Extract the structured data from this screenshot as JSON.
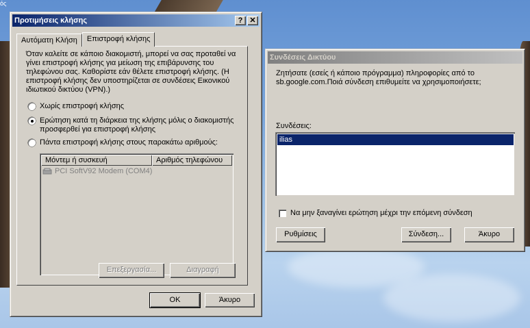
{
  "desktop": {
    "corner_text": "ός"
  },
  "call_prefs": {
    "title": "Προτιμήσεις κλήσης",
    "help_btn": "?",
    "close_btn": "✕",
    "tabs": [
      {
        "label": "Αυτόματη Κλήση"
      },
      {
        "label": "Επιστροφή κλήσης"
      }
    ],
    "description": "Όταν καλείτε σε κάποιο διακομιστή, μπορεί να σας προταθεί να γίνει επιστροφή κλήσης για μείωση της επιβάρυνσης του τηλεφώνου σας. Καθορίστε εάν θέλετε επιστροφή κλήσης. (Η επιστροφή κλήσης δεν υποστηρίζεται σε συνδέσεις Εικονικού ιδιωτικού δικτύου (VPN).)",
    "options": [
      {
        "label": "Χωρίς επιστροφή κλήσης",
        "checked": false
      },
      {
        "label": "Ερώτηση κατά τη διάρκεια της κλήσης μόλις ο διακομιστής προσφερθεί για επιστροφή κλήσης",
        "checked": true
      },
      {
        "label": "Πάντα επιστροφή κλήσης στους παρακάτω αριθμούς:",
        "checked": false
      }
    ],
    "columns": [
      "Μόντεμ ή συσκευή",
      "Αριθμός τηλεφώνου"
    ],
    "rows": [
      {
        "device": "PCI SoftV92 Modem (COM4)",
        "number": ""
      }
    ],
    "edit_btn": "Επεξεργασία...",
    "delete_btn": "Διαγραφή",
    "ok_btn": "OK",
    "cancel_btn": "Άκυρο"
  },
  "net_conn": {
    "title": "Συνδέσεις Δικτύου",
    "message": "Ζητήσατε (εσείς ή κάποιο πρόγραμμα) πληροφορίες από το sb.google.com.Ποιά σύνδεση επιθυμείτε να χρησιμοποιήσετε;",
    "connections_label": "Συνδέσεις:",
    "connections": [
      "ilias"
    ],
    "dont_ask_label": "Να μην ξαναγίνει ερώτηση μέχρι την επόμενη σύνδεση",
    "settings_btn": "Ρυθμίσεις",
    "connect_btn": "Σύνδεση...",
    "cancel_btn": "Άκυρο"
  },
  "colors": {
    "titlebar_active": "#0a246a",
    "titlebar_inactive": "#808080",
    "face": "#d4d0c8",
    "selection": "#0a246a"
  }
}
